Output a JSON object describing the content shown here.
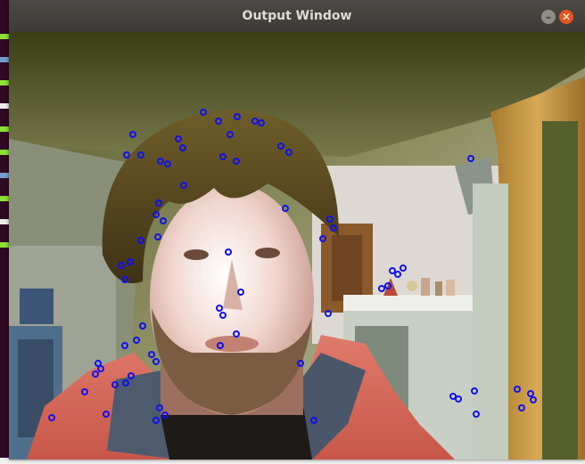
{
  "background_terminal": {
    "line_colors": [
      "#8ae234",
      "#729fcf",
      "#8ae234",
      "#eeeeec",
      "#8ae234",
      "#8ae234",
      "#729fcf",
      "#8ae234",
      "#eeeeec",
      "#8ae234"
    ]
  },
  "window": {
    "title": "Output Window",
    "minimize_icon": "minimize-icon",
    "close_icon": "close-icon",
    "accent_close": "#e95420"
  },
  "camera_view": {
    "overlay_marker_color": "#1010ee",
    "scene": "webcam frame of a young bearded man with brown hair in a red hoodie; shelf with figurines and a wooden door in background"
  }
}
